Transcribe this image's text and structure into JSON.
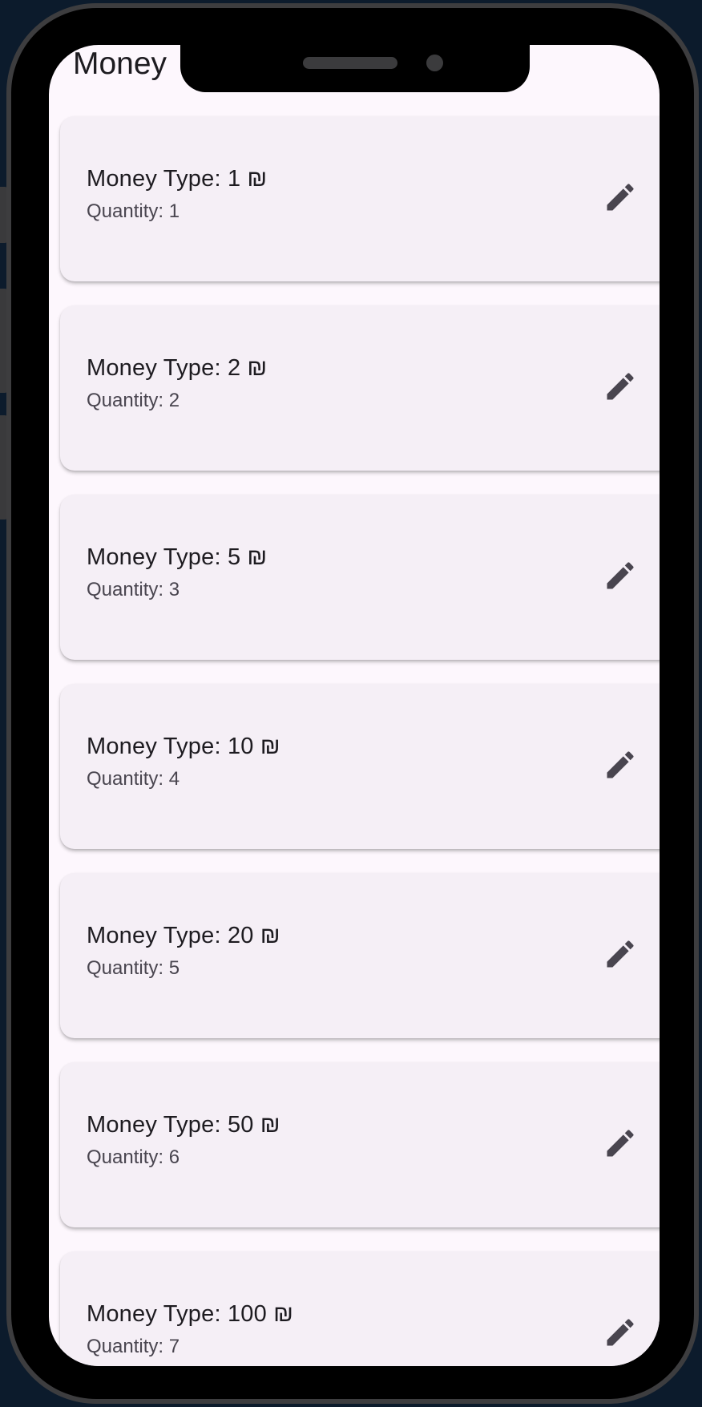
{
  "app": {
    "title": "Money"
  },
  "items": [
    {
      "money_type": "Money Type: 1 ₪",
      "quantity": "Quantity: 1"
    },
    {
      "money_type": "Money Type: 2 ₪",
      "quantity": "Quantity: 2"
    },
    {
      "money_type": "Money Type: 5 ₪",
      "quantity": "Quantity: 3"
    },
    {
      "money_type": "Money Type: 10 ₪",
      "quantity": "Quantity: 4"
    },
    {
      "money_type": "Money Type: 20 ₪",
      "quantity": "Quantity: 5"
    },
    {
      "money_type": "Money Type: 50 ₪",
      "quantity": "Quantity: 6"
    },
    {
      "money_type": "Money Type: 100 ₪",
      "quantity": "Quantity: 7"
    }
  ],
  "icons": {
    "edit": "pencil-icon"
  },
  "colors": {
    "background": "#0c1b2c",
    "screen": "#fdf7fd",
    "card": "#f5eff6",
    "text_primary": "#1d1b20",
    "text_secondary": "#49454f",
    "icon": "#49454f"
  }
}
